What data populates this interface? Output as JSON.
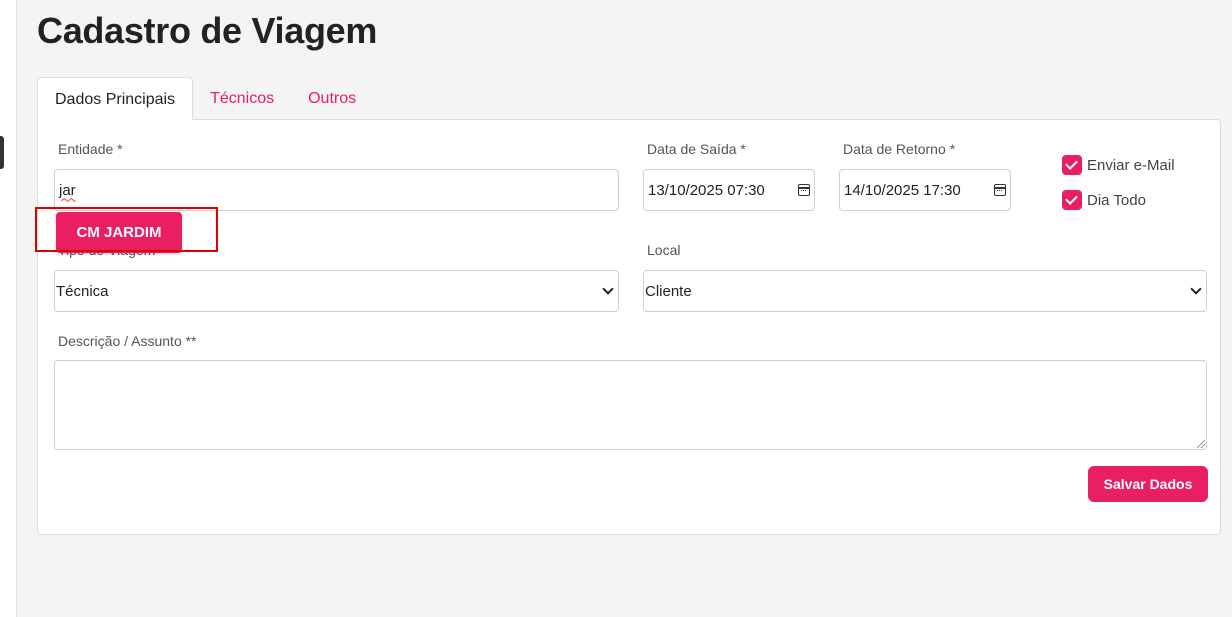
{
  "page": {
    "title": "Cadastro de Viagem"
  },
  "tabs": [
    {
      "label": "Dados Principais",
      "active": true
    },
    {
      "label": "Técnicos",
      "active": false
    },
    {
      "label": "Outros",
      "active": false
    }
  ],
  "form": {
    "entidade": {
      "label": "Entidade *",
      "value": "jar"
    },
    "data_saida": {
      "label": "Data de Saída *",
      "value": "13/10/2025 07:30"
    },
    "data_retorno": {
      "label": "Data de Retorno *",
      "value": "14/10/2025 17:30"
    },
    "enviar_email": {
      "label": "Enviar e-Mail",
      "checked": true
    },
    "dia_todo": {
      "label": "Dia Todo",
      "checked": true
    },
    "tipo_viagem": {
      "label": "Tipo de Viagem",
      "value": "Técnica"
    },
    "local": {
      "label": "Local",
      "value": "Cliente"
    },
    "descricao": {
      "label": "Descrição / Assunto **",
      "value": ""
    },
    "save_label": "Salvar Dados"
  },
  "autocomplete": {
    "suggestion": "CM JARDIM"
  },
  "colors": {
    "accent": "#e91e63",
    "highlight": "#e00000",
    "background": "#f4f4f4"
  }
}
